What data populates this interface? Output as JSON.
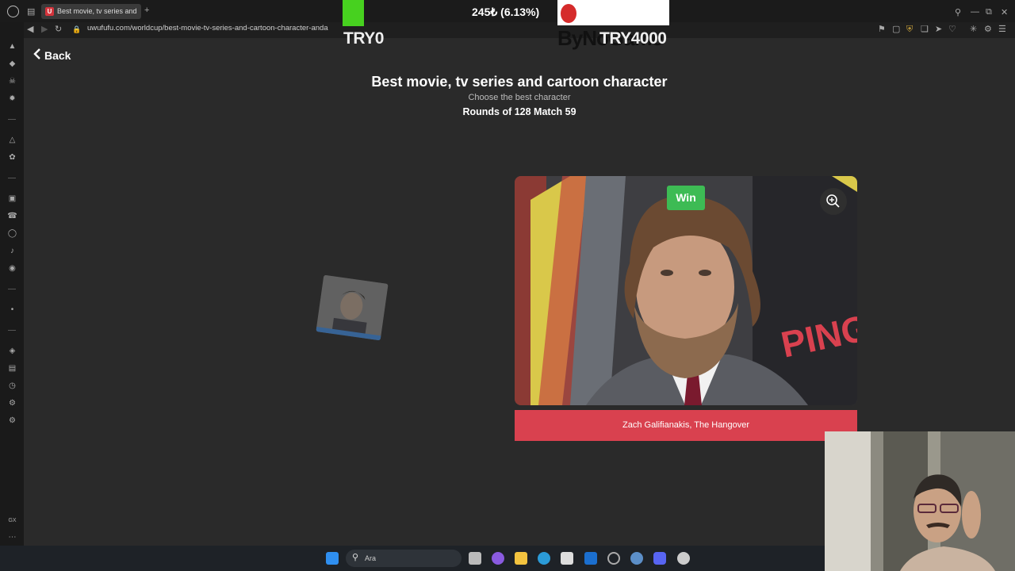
{
  "browser": {
    "tab_title": "Best movie, tv series and",
    "url": "uwufufu.com/worldcup/best-movie-tv-series-and-cartoon-character-anda",
    "new_tab_symbol": "+",
    "sidebar_label": "GX",
    "more_symbol": "⋯"
  },
  "stream_overlay": {
    "donation_text": "245₺ (6.13%)",
    "brand": "ByNoGame",
    "goal_start": "TRY0",
    "goal_end": "TRY4000",
    "progress_fraction": 0.0613,
    "progress_color": "#47d11f"
  },
  "page": {
    "back_label": "Back",
    "title": "Best movie, tv series and cartoon character",
    "subtitle": "Choose the best character",
    "rounds": "Rounds of 128 Match 59",
    "win_badge": "Win",
    "winner_caption": "Zach Galifianakis, The Hangover",
    "colors": {
      "win": "#3dbb54",
      "caption": "#d9414f"
    }
  },
  "taskbar": {
    "search_placeholder": "Ara"
  }
}
